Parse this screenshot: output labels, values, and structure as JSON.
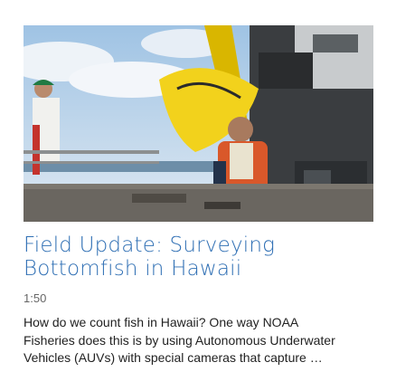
{
  "video": {
    "thumbnail_subject": "video-thumbnail",
    "title_lines": [
      "Field Update: Surveying",
      "Bottomfish in Hawaii"
    ],
    "duration": "1:50",
    "description_lines": [
      "How do we count fish in Hawaii? One way NOAA",
      "Fisheries does this is by using Autonomous Underwater",
      "Vehicles (AUVs) with special cameras that capture …"
    ]
  },
  "colors": {
    "title": "#2f6fb4",
    "duration": "#666666",
    "description": "#222222"
  }
}
